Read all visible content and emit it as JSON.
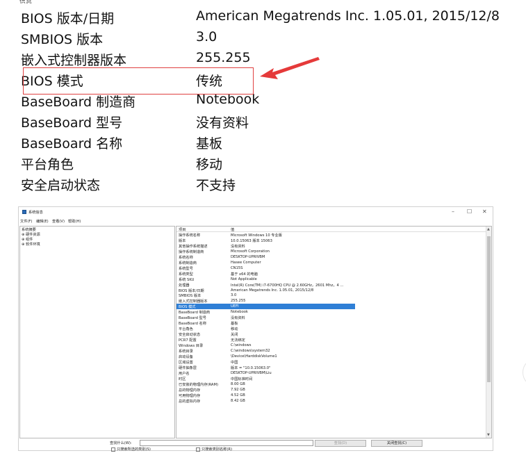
{
  "top_cut_text": "信息",
  "big_rows": [
    {
      "key": "BIOS 版本/日期",
      "value": "American Megatrends Inc. 1.05.01, 2015/12/8"
    },
    {
      "key": "SMBIOS 版本",
      "value": "3.0"
    },
    {
      "key": "嵌入式控制器版本",
      "value": "255.255"
    },
    {
      "key": "BIOS 模式",
      "value": "传统"
    },
    {
      "key": "BaseBoard 制造商",
      "value": "Notebook"
    },
    {
      "key": "BaseBoard 型号",
      "value": "没有资料"
    },
    {
      "key": "BaseBoard 名称",
      "value": "基板"
    },
    {
      "key": "平台角色",
      "value": "移动"
    },
    {
      "key": "安全启动状态",
      "value": "不支持"
    }
  ],
  "window": {
    "title": "系统信息",
    "controls": {
      "minimize": "–",
      "maximize": "☐",
      "close": "✕"
    },
    "menu": [
      "文件(F)",
      "编辑(E)",
      "查看(V)",
      "帮助(H)"
    ],
    "tree": [
      "系统摘要",
      "⊕ 硬件资源",
      "⊕ 组件",
      "⊕ 软件环境"
    ],
    "columns": {
      "item": "项目",
      "value": "值"
    },
    "rows": [
      {
        "item": "操作系统名称",
        "value": "Microsoft Windows 10 专业版"
      },
      {
        "item": "版本",
        "value": "10.0.15063 版本 15063"
      },
      {
        "item": "其他操作系统描述",
        "value": "没有资料"
      },
      {
        "item": "操作系统制造商",
        "value": "Microsoft Corporation"
      },
      {
        "item": "系统名称",
        "value": "DESKTOP-UPRIVBM"
      },
      {
        "item": "系统制造商",
        "value": "Hasee Computer"
      },
      {
        "item": "系统型号",
        "value": "CN15S"
      },
      {
        "item": "系统类型",
        "value": "基于 x64 的电脑"
      },
      {
        "item": "系统 SKU",
        "value": "Not Applicable"
      },
      {
        "item": "处理器",
        "value": "Intel(R) Core(TM) i7-6700HQ CPU @ 2.60GHz，2601 Mhz，4 ..."
      },
      {
        "item": "BIOS 版本/日期",
        "value": "American Megatrends Inc. 1.05.01, 2015/12/8"
      },
      {
        "item": "SMBIOS 版本",
        "value": "3.0"
      },
      {
        "item": "嵌入式控制器版本",
        "value": "255.255"
      },
      {
        "item": "BIOS 模式",
        "value": "UEFI"
      },
      {
        "item": "BaseBoard 制造商",
        "value": "Notebook"
      },
      {
        "item": "BaseBoard 型号",
        "value": "没有资料"
      },
      {
        "item": "BaseBoard 名称",
        "value": "基板"
      },
      {
        "item": "平台角色",
        "value": "移动"
      },
      {
        "item": "安全启动状态",
        "value": "关闭"
      },
      {
        "item": "PCR7 配置",
        "value": "无法绑定"
      },
      {
        "item": "Windows 目录",
        "value": "C:\\windows"
      },
      {
        "item": "系统目录",
        "value": "C:\\windows\\system32"
      },
      {
        "item": "启动设备",
        "value": "\\Device\\HarddiskVolume1"
      },
      {
        "item": "区域设置",
        "value": "中国"
      },
      {
        "item": "硬件抽象层",
        "value": "版本 = \"10.0.15063.0\""
      },
      {
        "item": "用户名",
        "value": "DESKTOP-UPRIVBM\\Liu"
      },
      {
        "item": "时区",
        "value": "中国标准时间"
      },
      {
        "item": "已安装的物理内存(RAM)",
        "value": "8.00 GB"
      },
      {
        "item": "总的物理内存",
        "value": "7.92 GB"
      },
      {
        "item": "可用物理内存",
        "value": "4.52 GB"
      },
      {
        "item": "总的虚拟内存",
        "value": "8.42 GB"
      }
    ],
    "selected_row_index": 13,
    "scroll_up": "▲",
    "scroll_down": "▼",
    "find": {
      "label": "查找什么(W):",
      "value": "",
      "find_button": "查找(D)",
      "close_button": "关闭查找(C)",
      "check_selected": "只搜索所选的类别(S)",
      "check_names": "只搜索类别名称(R)"
    }
  }
}
